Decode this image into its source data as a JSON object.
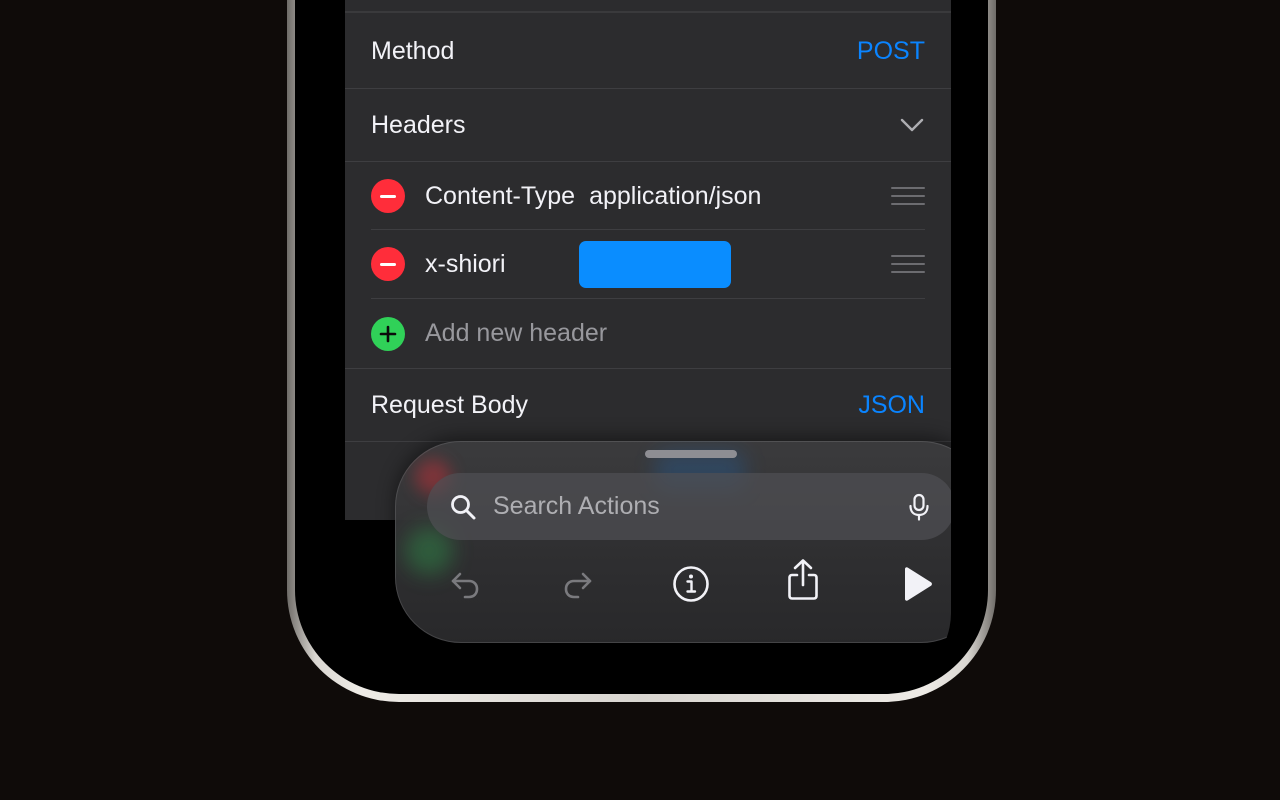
{
  "request": {
    "method_label": "Method",
    "method_value": "POST",
    "headers_label": "Headers",
    "headers": [
      {
        "key": "Content-Type",
        "value": "application/json"
      },
      {
        "key": "x-shiori",
        "value": ""
      }
    ],
    "add_header_placeholder": "Add new header",
    "body_label": "Request Body",
    "body_value": "JSON"
  },
  "sheet": {
    "search_placeholder": "Search Actions"
  },
  "icons": {
    "header_chevron": "chevron-down-icon",
    "remove": "minus-circle-icon",
    "add": "plus-circle-icon",
    "reorder": "drag-handle-icon",
    "search": "magnifying-glass-icon",
    "mic": "microphone-icon",
    "undo": "undo-icon",
    "redo": "redo-icon",
    "info": "info-icon",
    "share": "share-icon",
    "play": "play-icon"
  },
  "colors": {
    "accent": "#0a84ff",
    "remove": "#ff2d3a",
    "add": "#30d158",
    "card_background": "#2c2c2e",
    "page_background": "#0f0b09"
  }
}
